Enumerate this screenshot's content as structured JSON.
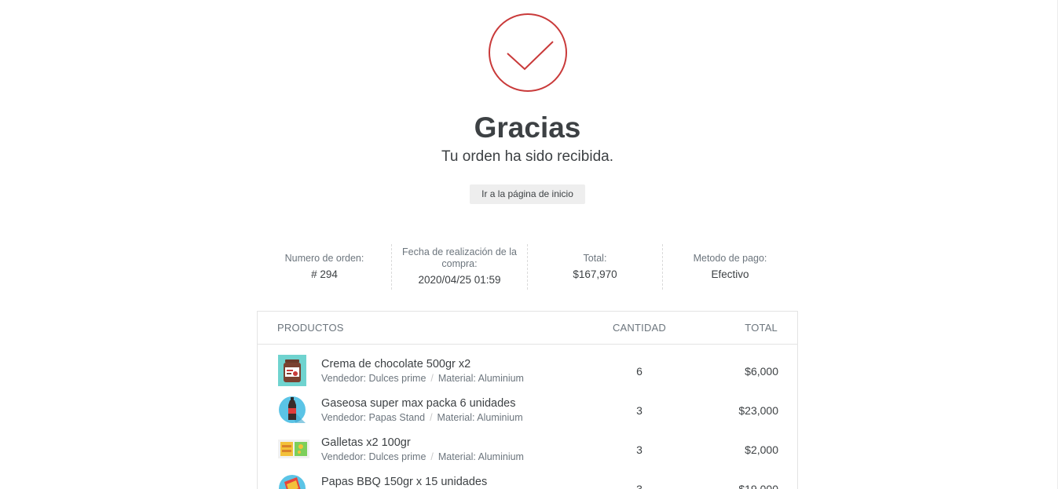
{
  "confirmation": {
    "title": "Gracias",
    "subtitle": "Tu orden ha sido recibida.",
    "home_button": "Ir a la página de inicio",
    "accent_color": "#c93a3a"
  },
  "summary": {
    "order_number_label": "Numero de orden:",
    "order_number_value": "# 294",
    "date_label": "Fecha de realización de la compra:",
    "date_value": "2020/04/25 01:59",
    "total_label": "Total:",
    "total_value": "$167,970",
    "payment_label": "Metodo de pago:",
    "payment_value": "Efectivo"
  },
  "products": {
    "headers": {
      "product": "PRODUCTOS",
      "quantity": "CANTIDAD",
      "total": "TOTAL"
    },
    "rows": [
      {
        "icon": "chocolate-jar-icon",
        "name": "Crema de chocolate 500gr x2",
        "vendor": "Vendedor: Dulces prime",
        "material": "Material: Aluminium",
        "quantity": "6",
        "total": "$6,000"
      },
      {
        "icon": "soda-bottle-icon",
        "name": "Gaseosa super max packa 6 unidades",
        "vendor": "Vendedor: Papas Stand",
        "material": "Material: Aluminium",
        "quantity": "3",
        "total": "$23,000"
      },
      {
        "icon": "cookies-pack-icon",
        "name": "Galletas x2 100gr",
        "vendor": "Vendedor: Dulces prime",
        "material": "Material: Aluminium",
        "quantity": "3",
        "total": "$2,000"
      },
      {
        "icon": "chips-bag-icon",
        "name": "Papas BBQ 150gr x 15 unidades",
        "vendor": "",
        "material": "",
        "quantity": "3",
        "total": "$19,000"
      }
    ]
  }
}
